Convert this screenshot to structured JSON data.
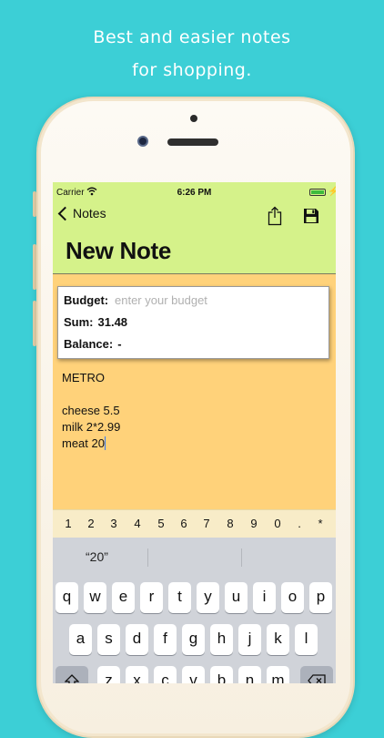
{
  "tagline": {
    "line1": "Best and easier notes",
    "line2": "for shopping."
  },
  "status": {
    "carrier": "Carrier",
    "time": "6:26 PM",
    "wifi_icon": "wifi-icon",
    "battery_icon": "battery-charging-icon"
  },
  "nav": {
    "back_label": "Notes",
    "share_icon": "share-icon",
    "save_icon": "floppy-disk-icon",
    "title": "New Note"
  },
  "budget": {
    "budget_label": "Budget:",
    "budget_placeholder": "enter your budget",
    "sum_label": "Sum:",
    "sum_value": "31.48",
    "balance_label": "Balance:",
    "balance_value": "-"
  },
  "note_lines": [
    "METRO",
    "",
    "cheese 5.5",
    "milk 2*2.99",
    "meat 20"
  ],
  "number_bar": [
    "1",
    "2",
    "3",
    "4",
    "5",
    "6",
    "7",
    "8",
    "9",
    "0",
    ".",
    "*"
  ],
  "keyboard": {
    "suggestion": "“20”",
    "row1": [
      "q",
      "w",
      "e",
      "r",
      "t",
      "y",
      "u",
      "i",
      "o",
      "p"
    ],
    "row2": [
      "a",
      "s",
      "d",
      "f",
      "g",
      "h",
      "j",
      "k",
      "l"
    ],
    "row3": [
      "z",
      "x",
      "c",
      "v",
      "b",
      "n",
      "m"
    ]
  },
  "colors": {
    "background": "#3ccfd6",
    "header": "#d5f28a",
    "note_paper": "#ffd27a",
    "number_bar": "#f8ecc8",
    "keyboard": "#d0d3d9",
    "caret": "#3477f5"
  }
}
